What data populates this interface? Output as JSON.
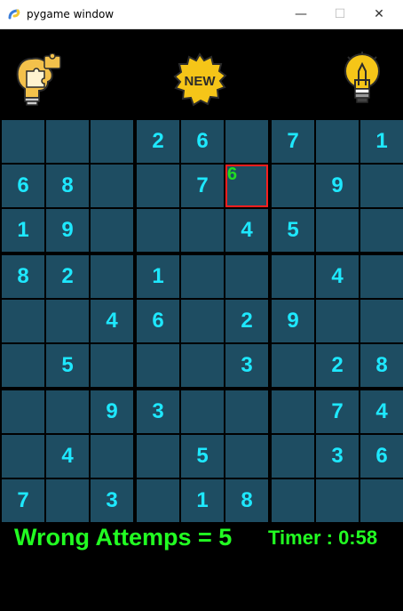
{
  "window": {
    "title": "pygame window",
    "minimize": "—",
    "maximize": "☐",
    "close": "✕"
  },
  "toolbar": {
    "new_label": "NEW",
    "colors": {
      "bulb": "#f5c518",
      "badge": "#f5c518"
    }
  },
  "board": {
    "rows": [
      [
        "",
        "",
        "",
        "2",
        "6",
        "",
        "7",
        "",
        "1"
      ],
      [
        "6",
        "8",
        "",
        "",
        "7",
        "",
        "",
        "9",
        ""
      ],
      [
        "1",
        "9",
        "",
        "",
        "",
        "4",
        "5",
        "",
        ""
      ],
      [
        "8",
        "2",
        "",
        "1",
        "",
        "",
        "",
        "4",
        ""
      ],
      [
        "",
        "",
        "4",
        "6",
        "",
        "2",
        "9",
        "",
        ""
      ],
      [
        "",
        "5",
        "",
        "",
        "",
        "3",
        "",
        "2",
        "8"
      ],
      [
        "",
        "",
        "9",
        "3",
        "",
        "",
        "",
        "7",
        "4"
      ],
      [
        "",
        "4",
        "",
        "",
        "5",
        "",
        "",
        "3",
        "6"
      ],
      [
        "7",
        "",
        "3",
        "",
        "1",
        "8",
        "",
        "",
        ""
      ]
    ],
    "selected": {
      "row": 1,
      "col": 5,
      "pencil": "6"
    },
    "colors": {
      "cell": "#1e4d62",
      "digit": "#1ee8ff",
      "selection": "#ff1e1e",
      "pencil": "#22dd22"
    }
  },
  "status": {
    "wrong_attempts": "Wrong Attemps = 5",
    "timer": "Timer : 0:58"
  }
}
